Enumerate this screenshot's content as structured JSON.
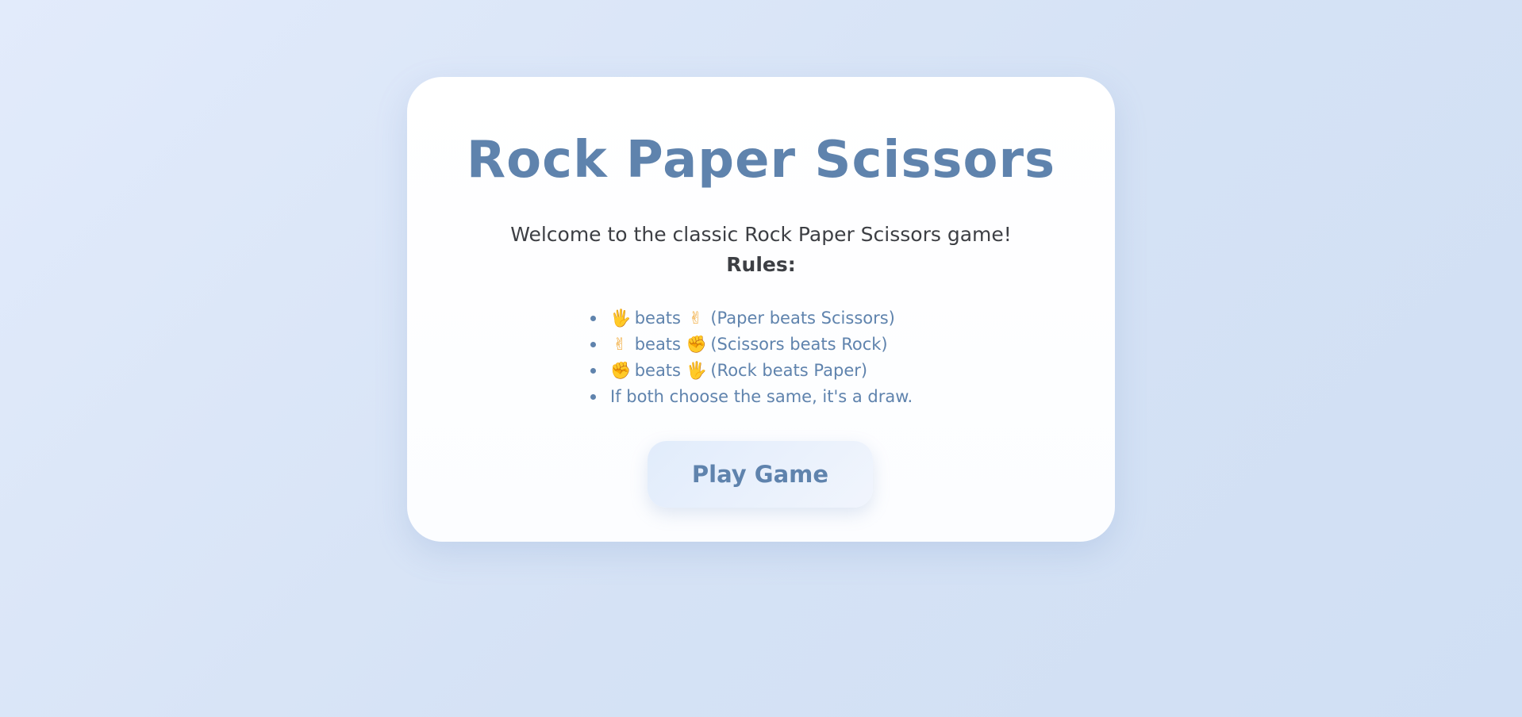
{
  "game": {
    "title": "Rock Paper Scissors",
    "welcome": "Welcome to the classic Rock Paper Scissors game!",
    "rules_heading": "Rules:",
    "rules": [
      {
        "emoji_a": "🖐",
        "word": "beats",
        "emoji_b": "✌",
        "text": "(Paper beats Scissors)"
      },
      {
        "emoji_a": "✌",
        "word": "beats",
        "emoji_b": "✊",
        "text": "(Scissors beats Rock)"
      },
      {
        "emoji_a": "✊",
        "word": "beats",
        "emoji_b": "🖐",
        "text": "(Rock beats Paper)"
      }
    ],
    "draw_rule": "If both choose the same, it's a draw.",
    "play_label": "Play Game"
  },
  "colors": {
    "accent": "#5f83ad",
    "text": "#3d3f44",
    "emoji": "#f0a32a",
    "background": "#dae5f7",
    "card": "#ffffff"
  },
  "icons": {
    "paper": "raised-hand-icon",
    "scissors": "victory-hand-icon",
    "rock": "raised-fist-icon"
  }
}
